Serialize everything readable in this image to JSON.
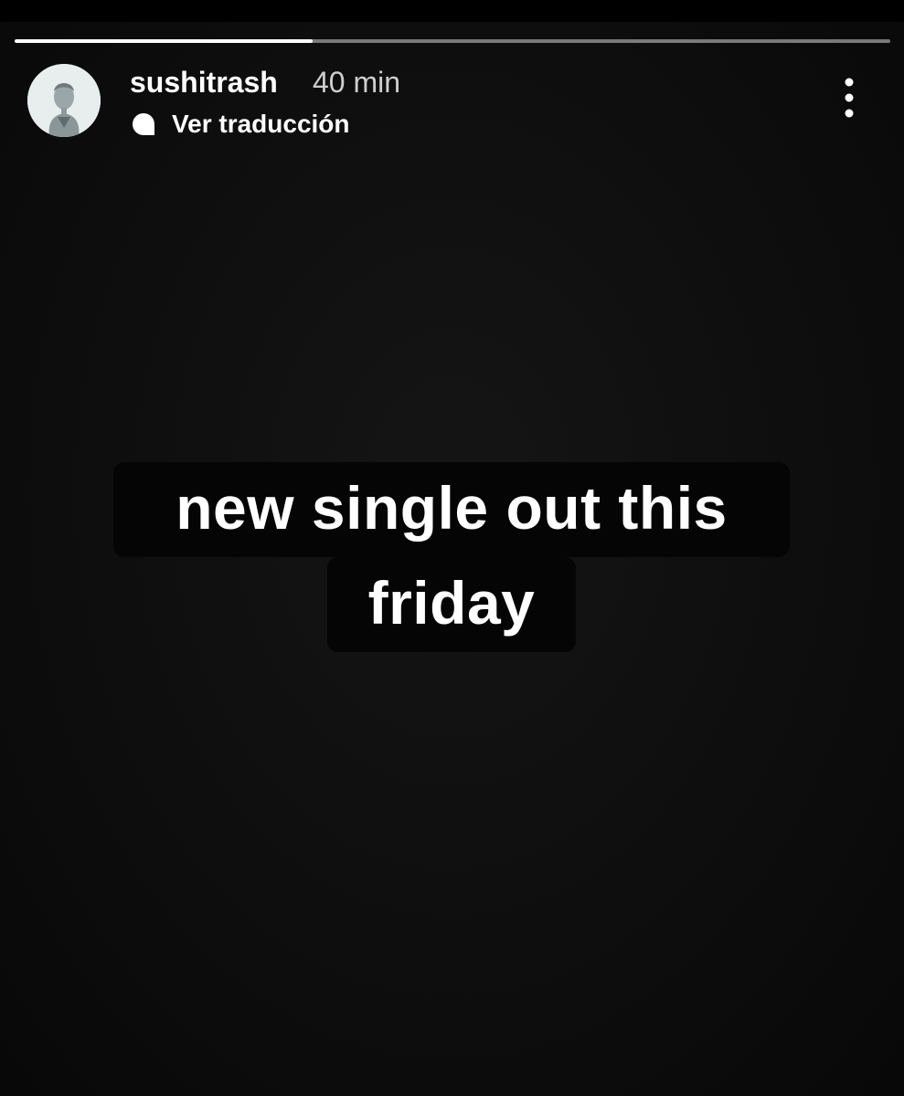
{
  "story": {
    "progress_fraction": 0.34,
    "user": {
      "username": "sushitrash",
      "time_ago": "40 min",
      "avatar_icon": "profile-avatar"
    },
    "translate": {
      "icon": "speech-bubble-icon",
      "label": "Ver traducción"
    },
    "more_icon": "more-vertical-icon",
    "caption": {
      "line1": "new single out this",
      "line2": "friday"
    }
  },
  "colors": {
    "background": "#0e0e0e",
    "text": "#ffffff",
    "time_text": "#cfcfcf",
    "progress_track": "rgba(255,255,255,0.45)",
    "caption_box": "#050505"
  }
}
